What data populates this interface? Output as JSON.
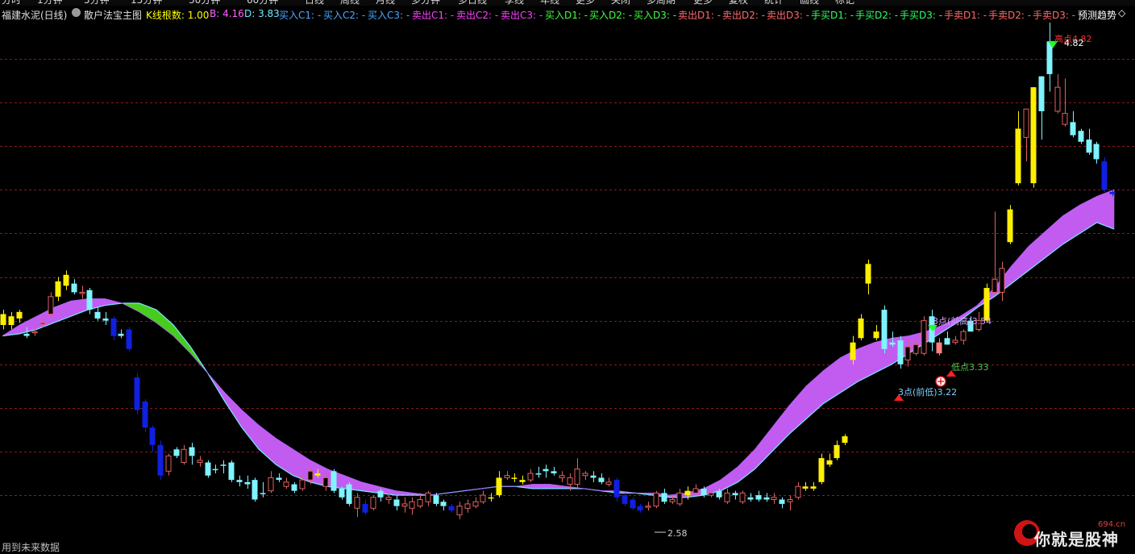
{
  "menu": [
    "分时",
    "1分钟",
    "5分钟",
    "15分钟",
    "30分钟",
    "60分钟",
    "日线",
    "周线",
    "月线",
    "多分钟",
    "多日线",
    "季线",
    "年线",
    "更多",
    "关闭",
    "多周期",
    "更多",
    "复权",
    "统计",
    "画线",
    "标记"
  ],
  "info": {
    "stock": "福建水泥(日线)",
    "indicator": "散户法宝主图",
    "k_count": "K线根数: 1.00",
    "b": "B: 4.16",
    "d": "D: 3.83",
    "buy_c1": "买入C1: -",
    "buy_c2": "买入C2: -",
    "buy_c3": "买入C3: -",
    "sell_c1": "卖出C1: -",
    "sell_c2": "卖出C2: -",
    "sell_c3": "卖出C3: -",
    "buy_d1": "买入D1: -",
    "buy_d2": "买入D2: -",
    "buy_d3": "买入D3: -",
    "sell_d1": "卖出D1: -",
    "sell_d2": "卖出D2: -",
    "sell_d3": "卖出D3: -",
    "hand_buy_d1": "手买D1: -",
    "hand_buy_d2": "手买D2: -",
    "hand_buy_d3": "手买D3: -",
    "hand_sell_d1": "手卖D1: -",
    "hand_sell_d2": "手卖D2: -",
    "hand_sell_d3": "手卖D3: -",
    "forecast": "预测趋势",
    "forecast_icon": "diamond-icon"
  },
  "colors": {
    "background": "#000000",
    "grid": "#8b1a1a",
    "up_yellow": "#ffef00",
    "up_cyan": "#7ff3ff",
    "down_blue": "#1020e0",
    "hollow_red": "#e06060",
    "band_green": "#47cc1d",
    "band_purple": "#c25cf0",
    "line_cyan": "#6fe8ff"
  },
  "annotations": {
    "top_label": "高点4.82",
    "top_value": "4.82",
    "bottom_value": "2.58",
    "prev_high": "3点(前高)3.54",
    "prev_low": "3点(前低)3.22",
    "mid_label": "低点3.33"
  },
  "chart_data": {
    "type": "candlestick",
    "ylim": [
      2.43,
      5.0
    ],
    "grid_levels": [
      2.65,
      2.85,
      3.05,
      3.25,
      3.45,
      3.65,
      3.85,
      4.05,
      4.25,
      4.45,
      4.65,
      4.85
    ],
    "candles": [
      [
        3.48,
        3.43,
        3.5,
        3.41,
        "y"
      ],
      [
        3.43,
        3.47,
        3.49,
        3.41,
        "y"
      ],
      [
        3.46,
        3.49,
        3.5,
        3.44,
        "y"
      ],
      [
        3.39,
        3.38,
        3.42,
        3.37,
        "c"
      ],
      [
        3.4,
        3.4,
        3.43,
        3.38,
        "r"
      ],
      [
        3.44,
        3.44,
        3.47,
        3.42,
        "r"
      ],
      [
        3.48,
        3.56,
        3.58,
        3.46,
        "r"
      ],
      [
        3.56,
        3.63,
        3.65,
        3.54,
        "y"
      ],
      [
        3.61,
        3.66,
        3.68,
        3.59,
        "y"
      ],
      [
        3.62,
        3.58,
        3.64,
        3.57,
        "c"
      ],
      [
        3.58,
        3.58,
        3.61,
        3.55,
        "r"
      ],
      [
        3.59,
        3.5,
        3.6,
        3.48,
        "c"
      ],
      [
        3.49,
        3.46,
        3.51,
        3.45,
        "c"
      ],
      [
        3.46,
        3.45,
        3.49,
        3.43,
        "c"
      ],
      [
        3.46,
        3.38,
        3.47,
        3.36,
        "b"
      ],
      [
        3.39,
        3.38,
        3.41,
        3.37,
        "c"
      ],
      [
        3.41,
        3.32,
        3.42,
        3.31,
        "b"
      ],
      [
        3.19,
        3.04,
        3.21,
        3.02,
        "b"
      ],
      [
        3.08,
        2.96,
        3.09,
        2.94,
        "b"
      ],
      [
        2.96,
        2.88,
        2.97,
        2.85,
        "b"
      ],
      [
        2.88,
        2.74,
        2.9,
        2.72,
        "b"
      ],
      [
        2.76,
        2.83,
        2.84,
        2.74,
        "r"
      ],
      [
        2.83,
        2.86,
        2.87,
        2.82,
        "c"
      ],
      [
        2.8,
        2.86,
        2.88,
        2.79,
        "r"
      ],
      [
        2.87,
        2.83,
        2.89,
        2.79,
        "c"
      ],
      [
        2.81,
        2.8,
        2.83,
        2.78,
        "r"
      ],
      [
        2.8,
        2.74,
        2.81,
        2.73,
        "c"
      ],
      [
        2.77,
        2.77,
        2.79,
        2.75,
        "c"
      ],
      [
        2.79,
        2.79,
        2.81,
        2.75,
        "c"
      ],
      [
        2.8,
        2.72,
        2.81,
        2.71,
        "c"
      ],
      [
        2.71,
        2.72,
        2.74,
        2.69,
        "c"
      ],
      [
        2.71,
        2.7,
        2.74,
        2.68,
        "c"
      ],
      [
        2.72,
        2.63,
        2.73,
        2.62,
        "c"
      ],
      [
        2.66,
        2.66,
        2.71,
        2.64,
        "c"
      ],
      [
        2.67,
        2.73,
        2.76,
        2.66,
        "r"
      ],
      [
        2.73,
        2.72,
        2.75,
        2.71,
        "c"
      ],
      [
        2.69,
        2.71,
        2.73,
        2.68,
        "r"
      ],
      [
        2.7,
        2.67,
        2.71,
        2.66,
        "c"
      ],
      [
        2.68,
        2.72,
        2.74,
        2.67,
        "r"
      ],
      [
        2.72,
        2.76,
        2.77,
        2.7,
        "r"
      ],
      [
        2.75,
        2.74,
        2.77,
        2.73,
        "y"
      ],
      [
        2.73,
        2.69,
        2.75,
        2.67,
        "r"
      ],
      [
        2.76,
        2.67,
        2.77,
        2.66,
        "c"
      ],
      [
        2.68,
        2.64,
        2.69,
        2.63,
        "c"
      ],
      [
        2.7,
        2.61,
        2.71,
        2.6,
        "c"
      ],
      [
        2.64,
        2.59,
        2.66,
        2.55,
        "r"
      ],
      [
        2.61,
        2.57,
        2.63,
        2.56,
        "b"
      ],
      [
        2.59,
        2.64,
        2.65,
        2.58,
        "r"
      ],
      [
        2.67,
        2.64,
        2.68,
        2.62,
        "c"
      ],
      [
        2.64,
        2.63,
        2.66,
        2.61,
        "r"
      ],
      [
        2.63,
        2.6,
        2.65,
        2.58,
        "c"
      ],
      [
        2.6,
        2.61,
        2.64,
        2.57,
        "r"
      ],
      [
        2.62,
        2.59,
        2.64,
        2.56,
        "r"
      ],
      [
        2.6,
        2.63,
        2.66,
        2.59,
        "r"
      ],
      [
        2.62,
        2.66,
        2.67,
        2.6,
        "r"
      ],
      [
        2.65,
        2.61,
        2.66,
        2.6,
        "c"
      ],
      [
        2.62,
        2.6,
        2.63,
        2.58,
        "c"
      ],
      [
        2.6,
        2.58,
        2.61,
        2.57,
        "b"
      ],
      [
        2.56,
        2.6,
        2.62,
        2.54,
        "r"
      ],
      [
        2.59,
        2.61,
        2.63,
        2.57,
        "r"
      ],
      [
        2.6,
        2.62,
        2.64,
        2.59,
        "r"
      ],
      [
        2.62,
        2.65,
        2.67,
        2.61,
        "r"
      ],
      [
        2.64,
        2.64,
        2.66,
        2.62,
        "y"
      ],
      [
        2.65,
        2.73,
        2.76,
        2.64,
        "y"
      ],
      [
        2.73,
        2.74,
        2.76,
        2.72,
        "r"
      ],
      [
        2.73,
        2.73,
        2.75,
        2.71,
        "y"
      ],
      [
        2.71,
        2.72,
        2.74,
        2.7,
        "y"
      ],
      [
        2.72,
        2.75,
        2.77,
        2.71,
        "r"
      ],
      [
        2.75,
        2.75,
        2.78,
        2.73,
        "c"
      ],
      [
        2.76,
        2.77,
        2.79,
        2.73,
        "c"
      ],
      [
        2.75,
        2.76,
        2.78,
        2.74,
        "c"
      ],
      [
        2.74,
        2.73,
        2.76,
        2.71,
        "r"
      ],
      [
        2.73,
        2.7,
        2.75,
        2.67,
        "r"
      ],
      [
        2.7,
        2.77,
        2.82,
        2.68,
        "r"
      ],
      [
        2.75,
        2.74,
        2.76,
        2.72,
        "r"
      ],
      [
        2.74,
        2.73,
        2.76,
        2.71,
        "c"
      ],
      [
        2.73,
        2.71,
        2.75,
        2.7,
        "c"
      ],
      [
        2.71,
        2.7,
        2.73,
        2.69,
        "r"
      ],
      [
        2.72,
        2.64,
        2.73,
        2.62,
        "b"
      ],
      [
        2.65,
        2.61,
        2.66,
        2.6,
        "b"
      ],
      [
        2.63,
        2.59,
        2.64,
        2.58,
        "b"
      ],
      [
        2.6,
        2.58,
        2.61,
        2.57,
        "b"
      ],
      [
        2.6,
        2.6,
        2.62,
        2.58,
        "r"
      ],
      [
        2.6,
        2.66,
        2.67,
        2.59,
        "r"
      ],
      [
        2.66,
        2.62,
        2.68,
        2.61,
        "c"
      ],
      [
        2.62,
        2.63,
        2.65,
        2.61,
        "r"
      ],
      [
        2.61,
        2.66,
        2.68,
        2.6,
        "r"
      ],
      [
        2.65,
        2.67,
        2.69,
        2.63,
        "y"
      ],
      [
        2.66,
        2.68,
        2.7,
        2.65,
        "r"
      ],
      [
        2.68,
        2.65,
        2.69,
        2.64,
        "c"
      ],
      [
        2.65,
        2.66,
        2.68,
        2.64,
        "r"
      ],
      [
        2.67,
        2.64,
        2.68,
        2.63,
        "c"
      ],
      [
        2.62,
        2.66,
        2.68,
        2.61,
        "r"
      ],
      [
        2.65,
        2.66,
        2.67,
        2.63,
        "c"
      ],
      [
        2.66,
        2.62,
        2.67,
        2.61,
        "r"
      ],
      [
        2.63,
        2.64,
        2.66,
        2.62,
        "c"
      ],
      [
        2.65,
        2.63,
        2.67,
        2.62,
        "c"
      ],
      [
        2.64,
        2.63,
        2.66,
        2.62,
        "c"
      ],
      [
        2.63,
        2.64,
        2.66,
        2.61,
        "r"
      ],
      [
        2.63,
        2.61,
        2.64,
        2.59,
        "c"
      ],
      [
        2.62,
        2.63,
        2.65,
        2.58,
        "r"
      ],
      [
        2.64,
        2.69,
        2.71,
        2.63,
        "r"
      ],
      [
        2.68,
        2.69,
        2.71,
        2.67,
        "y"
      ],
      [
        2.68,
        2.69,
        2.71,
        2.67,
        "y"
      ],
      [
        2.71,
        2.82,
        2.84,
        2.7,
        "y"
      ],
      [
        2.79,
        2.81,
        2.84,
        2.78,
        "y"
      ],
      [
        2.82,
        2.88,
        2.9,
        2.81,
        "y"
      ],
      [
        2.89,
        2.92,
        2.93,
        2.88,
        "y"
      ],
      [
        3.27,
        3.35,
        3.38,
        3.25,
        "y"
      ],
      [
        3.37,
        3.46,
        3.48,
        3.36,
        "y"
      ],
      [
        3.62,
        3.71,
        3.73,
        3.57,
        "y"
      ],
      [
        3.37,
        3.4,
        3.43,
        3.36,
        "y"
      ],
      [
        3.32,
        3.5,
        3.52,
        3.3,
        "c"
      ],
      [
        3.34,
        3.35,
        3.4,
        3.33,
        "c"
      ],
      [
        3.25,
        3.36,
        3.38,
        3.23,
        "c"
      ],
      [
        3.27,
        3.33,
        3.36,
        3.24,
        "r"
      ],
      [
        3.3,
        3.34,
        3.36,
        3.29,
        "r"
      ],
      [
        3.3,
        3.45,
        3.47,
        3.29,
        "r"
      ],
      [
        3.35,
        3.47,
        3.5,
        3.31,
        "c"
      ],
      [
        3.35,
        3.3,
        3.37,
        3.29,
        "p"
      ],
      [
        3.37,
        3.34,
        3.4,
        3.34,
        "c"
      ],
      [
        3.35,
        3.36,
        3.38,
        3.34,
        "r"
      ],
      [
        3.36,
        3.4,
        3.41,
        3.34,
        "r"
      ],
      [
        3.4,
        3.45,
        3.47,
        3.4,
        "c"
      ],
      [
        3.41,
        3.45,
        3.49,
        3.4,
        "r"
      ],
      [
        3.45,
        3.6,
        3.62,
        3.44,
        "y"
      ],
      [
        3.58,
        3.64,
        3.95,
        3.57,
        "r"
      ],
      [
        3.58,
        3.69,
        3.72,
        3.54,
        "r"
      ],
      [
        3.81,
        3.96,
        3.98,
        3.8,
        "y"
      ],
      [
        4.08,
        4.33,
        4.41,
        4.07,
        "y"
      ],
      [
        4.29,
        4.42,
        4.41,
        4.18,
        "r"
      ],
      [
        4.08,
        4.52,
        4.52,
        4.06,
        "y"
      ],
      [
        4.41,
        4.57,
        4.57,
        4.28,
        "c"
      ],
      [
        4.58,
        4.73,
        4.82,
        4.5,
        "c"
      ],
      [
        4.52,
        4.41,
        4.58,
        4.4,
        "r"
      ],
      [
        4.4,
        4.35,
        4.56,
        4.34,
        "r"
      ],
      [
        4.36,
        4.3,
        4.41,
        4.29,
        "c"
      ],
      [
        4.32,
        4.27,
        4.33,
        4.26,
        "c"
      ],
      [
        4.28,
        4.22,
        4.33,
        4.21,
        "c"
      ],
      [
        4.26,
        4.19,
        4.27,
        4.17,
        "c"
      ],
      [
        4.18,
        4.05,
        4.2,
        4.04,
        "b"
      ],
      [
        4.04,
        4.03,
        4.05,
        4.02,
        "b"
      ]
    ],
    "band_a": [
      3.38,
      3.43,
      3.47,
      3.51,
      3.54,
      3.55,
      3.55,
      3.53,
      3.49,
      3.44,
      3.38,
      3.3,
      3.21,
      3.12,
      3.04,
      2.97,
      2.91,
      2.86,
      2.81,
      2.77,
      2.74,
      2.71,
      2.69,
      2.67,
      2.66,
      2.65,
      2.66,
      2.67,
      2.68,
      2.69,
      2.69,
      2.7,
      2.7,
      2.69,
      2.68,
      2.67,
      2.67,
      2.66,
      2.66,
      2.65,
      2.66,
      2.68,
      2.72,
      2.78,
      2.86,
      2.96,
      3.06,
      3.15,
      3.22,
      3.28,
      3.32,
      3.35,
      3.37,
      3.38,
      3.4,
      3.43,
      3.47,
      3.52,
      3.6,
      3.7,
      3.79,
      3.86,
      3.93,
      3.98,
      4.02,
      4.05
    ],
    "band_b": [
      3.38,
      3.39,
      3.41,
      3.44,
      3.47,
      3.5,
      3.52,
      3.53,
      3.53,
      3.5,
      3.43,
      3.33,
      3.21,
      3.08,
      2.96,
      2.86,
      2.79,
      2.74,
      2.71,
      2.69,
      2.68,
      2.67,
      2.66,
      2.65,
      2.65,
      2.65,
      2.66,
      2.67,
      2.68,
      2.69,
      2.69,
      2.68,
      2.68,
      2.68,
      2.68,
      2.67,
      2.66,
      2.66,
      2.65,
      2.64,
      2.64,
      2.65,
      2.67,
      2.71,
      2.77,
      2.85,
      2.93,
      3.0,
      3.07,
      3.12,
      3.17,
      3.21,
      3.25,
      3.3,
      3.35,
      3.4,
      3.45,
      3.51,
      3.56,
      3.62,
      3.68,
      3.74,
      3.8,
      3.85,
      3.9,
      3.87
    ],
    "band_x0": 3,
    "band_x1": 1382
  }
}
